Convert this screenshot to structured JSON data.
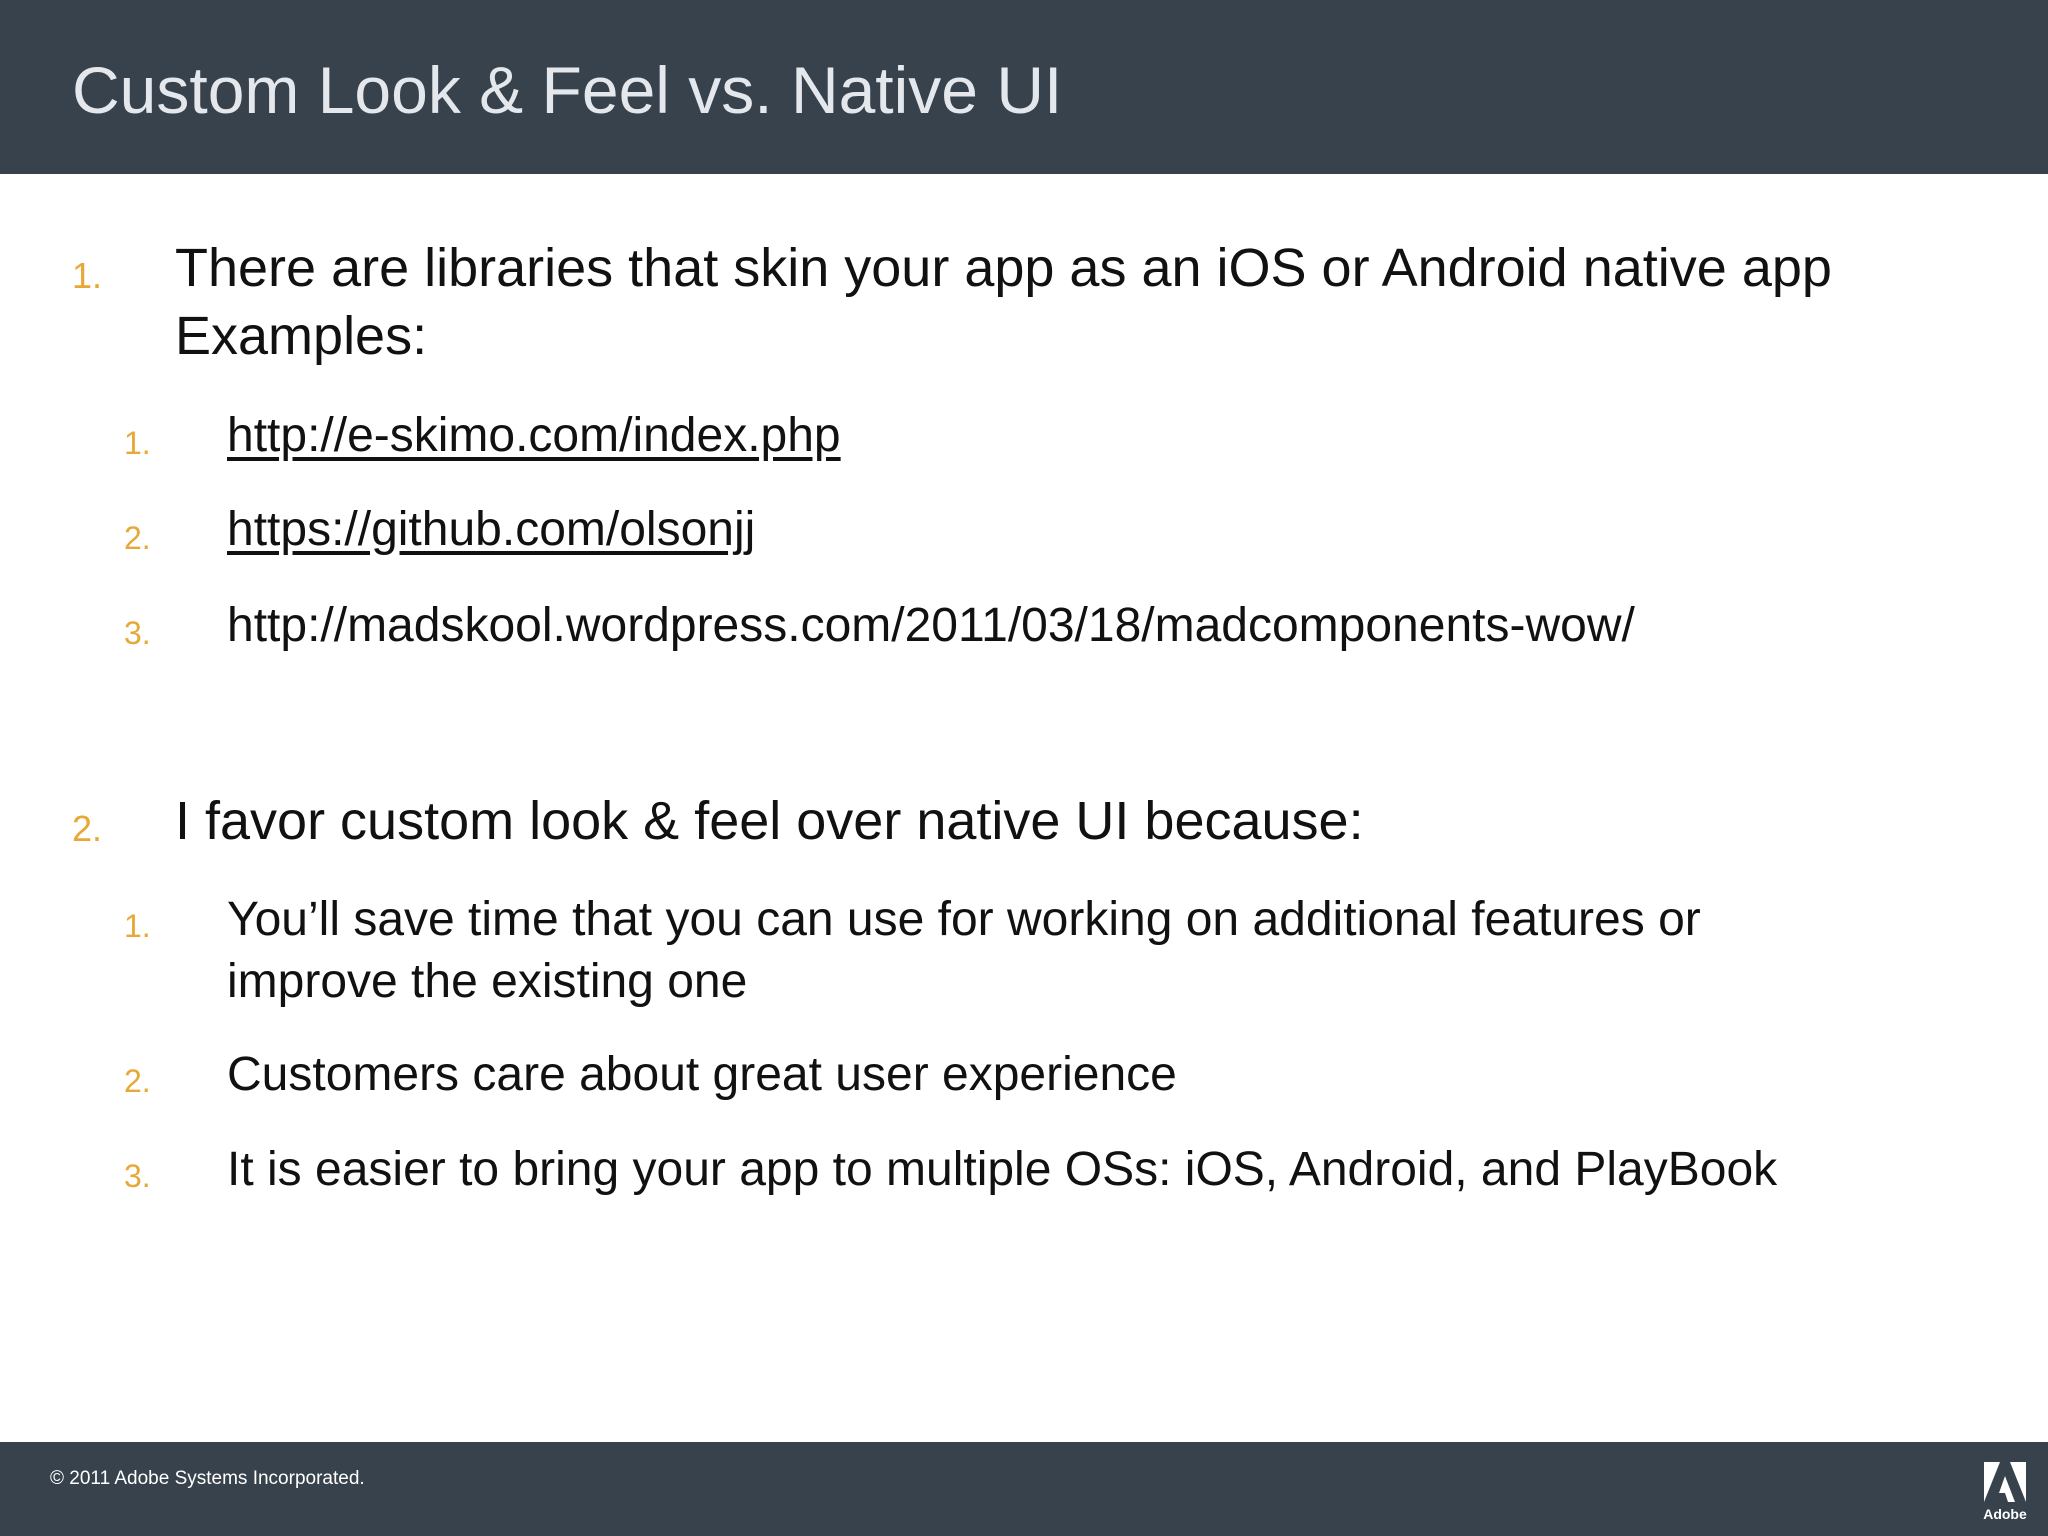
{
  "slide": {
    "title": "Custom Look & Feel vs. Native UI"
  },
  "content": {
    "item1": {
      "number": "1.",
      "line1": "There are libraries that skin your app as an iOS or Android native app",
      "line2": "Examples:",
      "subitems": [
        {
          "number": "1.",
          "text": "http://e-skimo.com/index.php"
        },
        {
          "number": "2.",
          "text": "https://github.com/olsonjj"
        },
        {
          "number": "3.",
          "text": "http://madskool.wordpress.com/2011/03/18/madcomponents-wow/"
        }
      ]
    },
    "item2": {
      "number": "2.",
      "line1": "I favor custom look & feel over native UI because:",
      "subitems": [
        {
          "number": "1.",
          "line1": "You’ll save time that you can use for working on additional features or",
          "line2": "improve the existing one"
        },
        {
          "number": "2.",
          "text": "Customers care about great user experience"
        },
        {
          "number": "3.",
          "text": "It is easier to bring your app to multiple OSs: iOS, Android, and PlayBook"
        }
      ]
    }
  },
  "footer": {
    "copyright": "© 2011 Adobe Systems Incorporated.",
    "logo_icon": "adobe-logo-icon",
    "logo_text": "Adobe"
  },
  "colors": {
    "header_bg": "#37424d",
    "number_accent": "#e8a838",
    "body_text": "#111111"
  }
}
